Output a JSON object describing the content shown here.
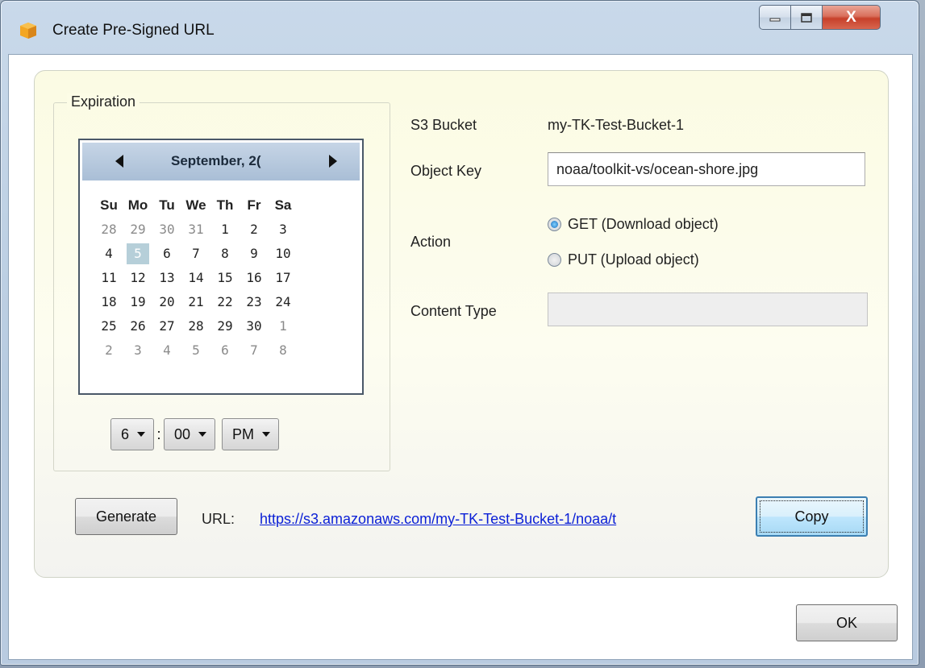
{
  "window": {
    "title": "Create Pre-Signed URL",
    "close_glyph": "X"
  },
  "expiration": {
    "group_label": "Expiration",
    "calendar": {
      "month_title": "September, 2(",
      "weekdays": [
        "Su",
        "Mo",
        "Tu",
        "We",
        "Th",
        "Fr",
        "Sa"
      ],
      "days": [
        {
          "d": "28",
          "dim": true
        },
        {
          "d": "29",
          "dim": true
        },
        {
          "d": "30",
          "dim": true
        },
        {
          "d": "31",
          "dim": true
        },
        {
          "d": "1",
          "dim": false
        },
        {
          "d": "2",
          "dim": false
        },
        {
          "d": "3",
          "dim": false
        },
        {
          "d": "4",
          "dim": false
        },
        {
          "d": "5",
          "dim": false,
          "selected": true
        },
        {
          "d": "6",
          "dim": false
        },
        {
          "d": "7",
          "dim": false
        },
        {
          "d": "8",
          "dim": false
        },
        {
          "d": "9",
          "dim": false
        },
        {
          "d": "10",
          "dim": false
        },
        {
          "d": "11",
          "dim": false
        },
        {
          "d": "12",
          "dim": false
        },
        {
          "d": "13",
          "dim": false
        },
        {
          "d": "14",
          "dim": false
        },
        {
          "d": "15",
          "dim": false
        },
        {
          "d": "16",
          "dim": false
        },
        {
          "d": "17",
          "dim": false
        },
        {
          "d": "18",
          "dim": false
        },
        {
          "d": "19",
          "dim": false
        },
        {
          "d": "20",
          "dim": false
        },
        {
          "d": "21",
          "dim": false
        },
        {
          "d": "22",
          "dim": false
        },
        {
          "d": "23",
          "dim": false
        },
        {
          "d": "24",
          "dim": false
        },
        {
          "d": "25",
          "dim": false
        },
        {
          "d": "26",
          "dim": false
        },
        {
          "d": "27",
          "dim": false
        },
        {
          "d": "28",
          "dim": false
        },
        {
          "d": "29",
          "dim": false
        },
        {
          "d": "30",
          "dim": false
        },
        {
          "d": "1",
          "dim": true
        },
        {
          "d": "2",
          "dim": true
        },
        {
          "d": "3",
          "dim": true
        },
        {
          "d": "4",
          "dim": true
        },
        {
          "d": "5",
          "dim": true
        },
        {
          "d": "6",
          "dim": true
        },
        {
          "d": "7",
          "dim": true
        },
        {
          "d": "8",
          "dim": true
        }
      ]
    },
    "hour": "6",
    "separator": ":",
    "minute": "00",
    "ampm": "PM"
  },
  "form": {
    "bucket_label": "S3 Bucket",
    "bucket_value": "my-TK-Test-Bucket-1",
    "object_key_label": "Object Key",
    "object_key_value": "noaa/toolkit-vs/ocean-shore.jpg",
    "action_label": "Action",
    "action_options": [
      {
        "label": "GET (Download object)",
        "selected": true
      },
      {
        "label": "PUT (Upload object)",
        "selected": false
      }
    ],
    "content_type_label": "Content Type",
    "content_type_value": ""
  },
  "footer": {
    "generate_label": "Generate",
    "url_label": "URL:",
    "url_value": "https://s3.amazonaws.com/my-TK-Test-Bucket-1/noaa/t",
    "copy_label": "Copy",
    "ok_label": "OK"
  },
  "colors": {
    "link": "#0a1fd6",
    "panel_bg": "#fbfbe3",
    "selected_day": "#b6cfd9",
    "close_button": "#c7402a"
  }
}
